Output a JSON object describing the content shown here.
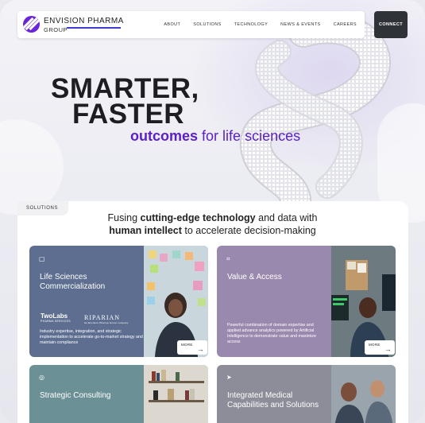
{
  "brand": {
    "name_line1": "ENVISION PHARMA",
    "name_line2": "GROUP",
    "accent_color": "#6a25d9"
  },
  "nav": {
    "items": [
      "ABOUT",
      "SOLUTIONS",
      "TECHNOLOGY",
      "NEWS & EVENTS",
      "CAREERS"
    ],
    "connect_label": "CONNECT"
  },
  "hero": {
    "title_line1": "SMARTER,",
    "title_line2": "FASTER",
    "subtitle_accent": "outcomes",
    "subtitle_rest": "for life sciences"
  },
  "solutions": {
    "tab_label": "SOLUTIONS",
    "tagline": {
      "p1": "Fusing ",
      "b1": "cutting-edge technology",
      "p2": " and data with",
      "b2": "human intellect",
      "p3": " to accelerate decision-making"
    },
    "cards": [
      {
        "title": "Life Sciences Commercialization",
        "icon": "monitor-icon",
        "description": "Industry expertise, integration, and strategic implementation to accelerate go-to-market strategy and maintain compliance",
        "partners": [
          "TwoLabs",
          "RIPARIAN"
        ],
        "partner1_sub": "PHARMA SERVICES",
        "partner2_sub": "An Envision Pharma Group company",
        "more_label": "MORE"
      },
      {
        "title": "Value & Access",
        "icon": "chart-icon",
        "description": "Powerful combination of domain expertise and applied advance analytics powered by Artificial Intelligence to demonstrate value and maximize access",
        "more_label": "MORE"
      },
      {
        "title": "Strategic Consulting",
        "icon": "compass-icon"
      },
      {
        "title": "Integrated Medical Capabilities and Solutions",
        "icon": "send-icon"
      }
    ]
  }
}
